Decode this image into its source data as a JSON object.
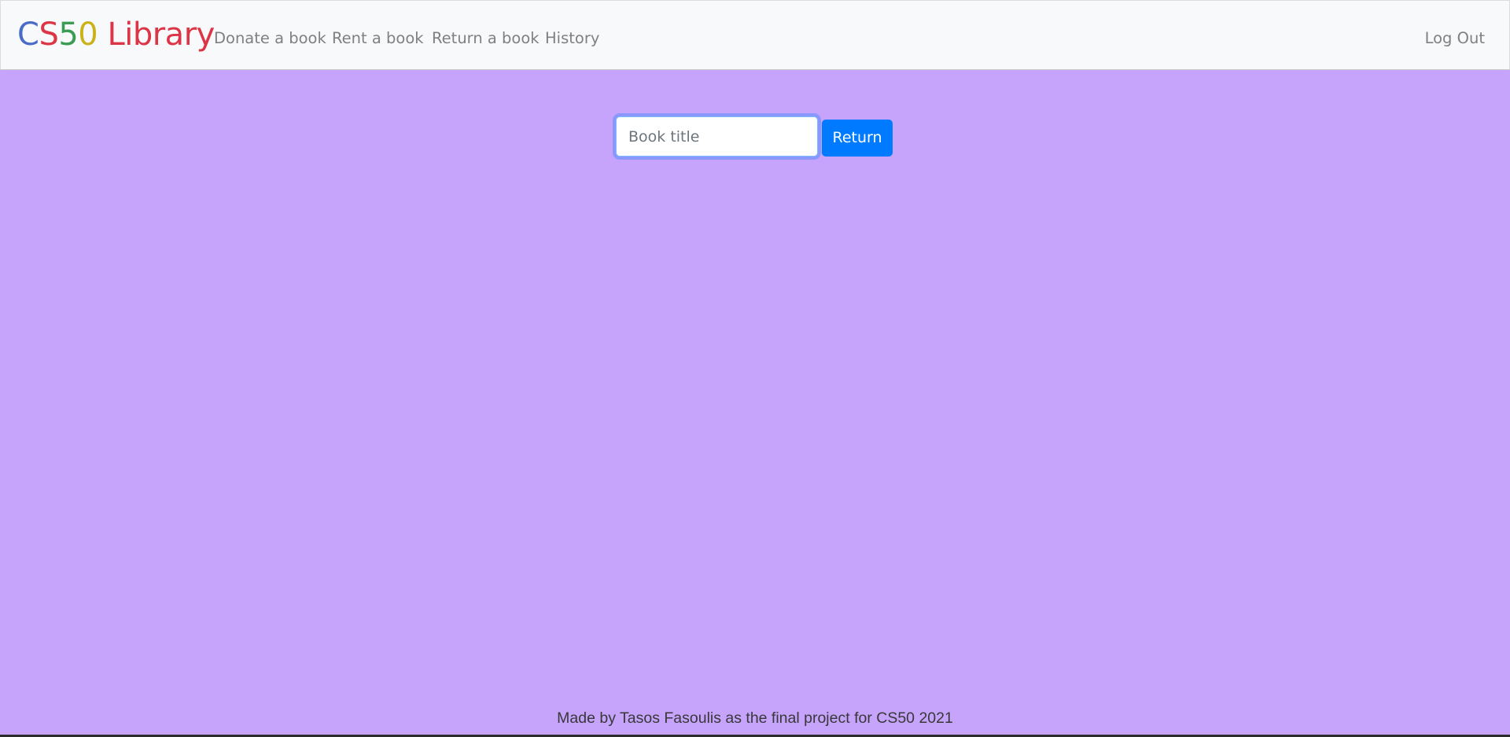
{
  "navbar": {
    "brand": {
      "parts": [
        {
          "text": "C",
          "color": "#4a6cc9"
        },
        {
          "text": "S",
          "color": "#dc3545"
        },
        {
          "text": "5",
          "color": "#3a9c52"
        },
        {
          "text": "0",
          "color": "#c9b21a"
        },
        {
          "text": " Library",
          "color": "#dc3545"
        }
      ]
    },
    "links": {
      "donate": "Donate a book",
      "rent": "Rent a book",
      "return": "Return a book",
      "history": "History"
    },
    "logout": "Log Out"
  },
  "form": {
    "input_placeholder": "Book title",
    "input_value": "",
    "button_label": "Return",
    "accent_color": "#007bff"
  },
  "footer": {
    "text": "Made by Tasos Fasoulis as the final project for CS50 2021"
  },
  "colors": {
    "background": "#c6a4fc",
    "navbar": "#f8f9fa"
  }
}
